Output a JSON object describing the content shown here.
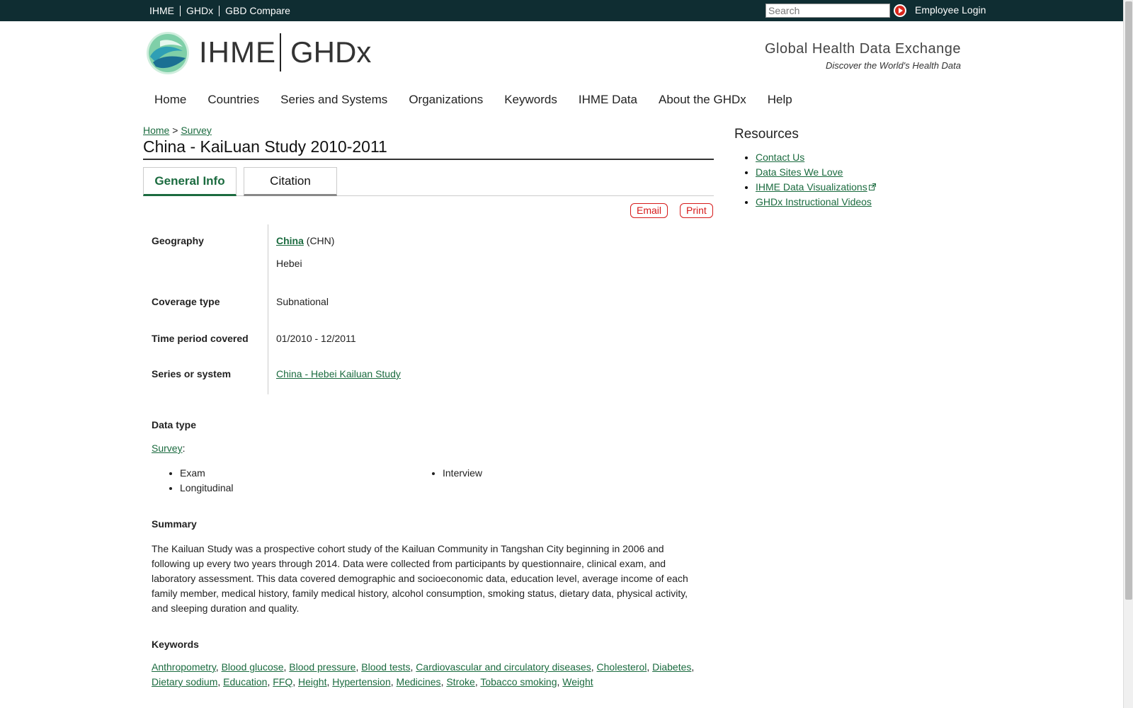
{
  "topbar": {
    "links": [
      "IHME",
      "GHDx",
      "GBD Compare"
    ],
    "search_placeholder": "Search",
    "employee_login": "Employee Login"
  },
  "header": {
    "logo_ihme": "IHME",
    "logo_ghdx": "GHDx",
    "tagline_title": "Global Health Data Exchange",
    "tagline_sub": "Discover the World's Health Data"
  },
  "nav": [
    "Home",
    "Countries",
    "Series and Systems",
    "Organizations",
    "Keywords",
    "IHME Data",
    "About the GHDx",
    "Help"
  ],
  "breadcrumb": {
    "home": "Home",
    "sep": ">",
    "current": "Survey"
  },
  "page": {
    "title": "China - KaiLuan Study 2010-2011",
    "tabs": [
      "General Info",
      "Citation"
    ],
    "email_btn": "Email",
    "print_btn": "Print"
  },
  "fields": {
    "geography_label": "Geography",
    "geography_country": "China",
    "geography_code": "(CHN)",
    "geography_region": "Hebei",
    "coverage_label": "Coverage type",
    "coverage_value": "Subnational",
    "time_label": "Time period covered",
    "time_value": "01/2010 - 12/2011",
    "series_label": "Series or system",
    "series_value": "China - Hebei Kailuan Study"
  },
  "data_type": {
    "heading": "Data type",
    "link": "Survey",
    "col1": [
      "Exam",
      "Longitudinal"
    ],
    "col2": [
      "Interview"
    ]
  },
  "summary": {
    "heading": "Summary",
    "text": "The Kailuan Study was a prospective cohort study of the Kailuan Community in Tangshan City beginning in 2006 and following up every two years through 2014. Data were collected from participants by questionnaire, clinical exam, and laboratory assessment. This data covered demographic and socioeconomic data, education level, average income of each family member, medical history, family medical history, alcohol consumption, smoking status, dietary data, physical activity, and sleeping duration and quality."
  },
  "keywords": {
    "heading": "Keywords",
    "items": [
      "Anthropometry",
      "Blood glucose",
      "Blood pressure",
      "Blood tests",
      "Cardiovascular and circulatory diseases",
      "Cholesterol",
      "Diabetes",
      "Dietary sodium",
      "Education",
      "FFQ",
      "Height",
      "Hypertension",
      "Medicines",
      "Stroke",
      "Tobacco smoking",
      "Weight"
    ]
  },
  "resources": {
    "heading": "Resources",
    "items": [
      "Contact Us",
      "Data Sites We Love",
      "IHME Data Visualizations",
      "GHDx Instructional Videos"
    ]
  },
  "colors": {
    "topbar": "#0f2d32",
    "link": "#1b6b3f",
    "action_red": "#d61a1a"
  }
}
